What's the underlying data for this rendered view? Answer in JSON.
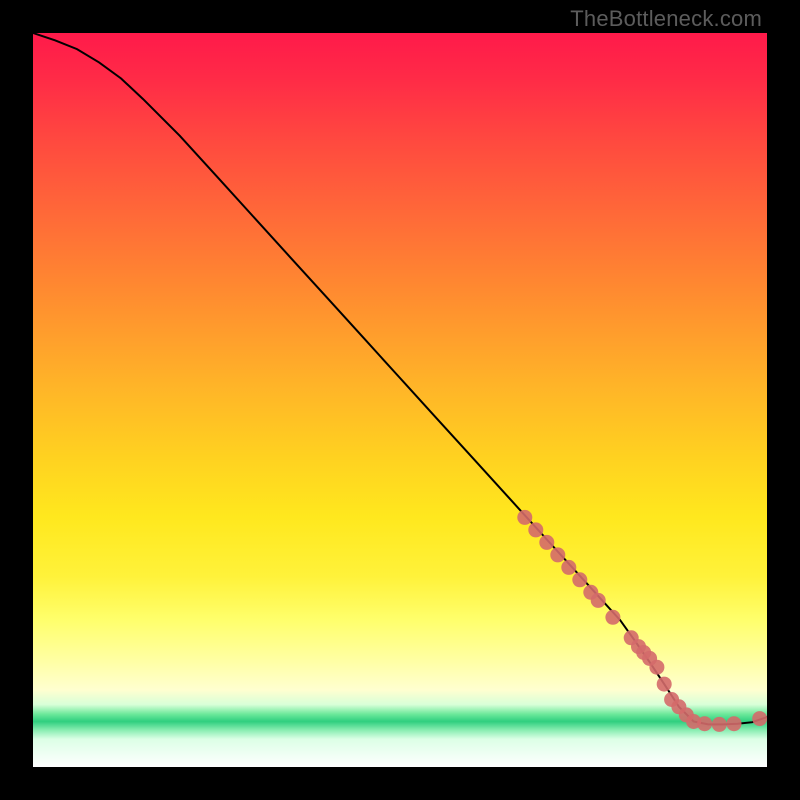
{
  "watermark": "TheBottleneck.com",
  "chart_data": {
    "type": "line",
    "title": "",
    "xlabel": "",
    "ylabel": "",
    "xlim": [
      0,
      100
    ],
    "ylim": [
      0,
      100
    ],
    "grid": false,
    "legend": false,
    "series": [
      {
        "name": "curve",
        "style": "line",
        "color": "#000000",
        "x": [
          0,
          3,
          6,
          9,
          12,
          15,
          20,
          25,
          30,
          35,
          40,
          45,
          50,
          55,
          60,
          65,
          70,
          75,
          80,
          82,
          84,
          86,
          88,
          90,
          92,
          94,
          96,
          98,
          100
        ],
        "y": [
          100,
          99,
          97.8,
          96,
          93.8,
          91,
          86,
          80.5,
          75,
          69.5,
          64,
          58.5,
          53,
          47.5,
          42,
          36.5,
          31,
          25.5,
          20,
          17.2,
          14.3,
          11.3,
          8.2,
          6.2,
          5.8,
          5.8,
          5.9,
          6.1,
          6.8
        ]
      },
      {
        "name": "highlight-points",
        "style": "scatter",
        "color": "#d46a6a",
        "x": [
          67,
          68.5,
          70,
          71.5,
          73,
          74.5,
          76,
          77,
          79,
          81.5,
          82.5,
          83.2,
          84,
          85,
          86,
          87,
          88,
          89,
          90,
          91.5,
          93.5,
          95.5,
          99
        ],
        "y": [
          34,
          32.3,
          30.6,
          28.9,
          27.2,
          25.5,
          23.8,
          22.7,
          20.4,
          17.6,
          16.4,
          15.6,
          14.8,
          13.6,
          11.3,
          9.2,
          8.2,
          7.1,
          6.2,
          5.9,
          5.8,
          5.9,
          6.6
        ]
      }
    ],
    "gradient_bands": [
      {
        "y": 100,
        "color": "#ff1a4a"
      },
      {
        "y": 50,
        "color": "#ffa82a"
      },
      {
        "y": 25,
        "color": "#ffe81e"
      },
      {
        "y": 12,
        "color": "#ffff9e"
      },
      {
        "y": 7,
        "color": "#2fcf7f"
      },
      {
        "y": 0,
        "color": "#ffffff"
      }
    ]
  }
}
